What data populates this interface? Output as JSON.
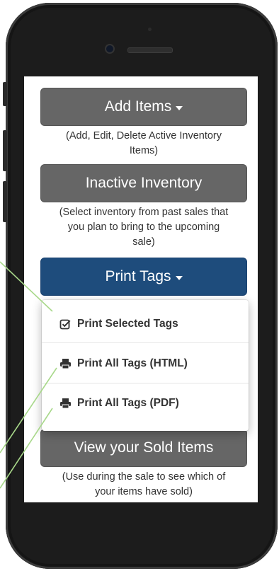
{
  "buttons": {
    "add_items": "Add Items",
    "inactive_inventory": "Inactive Inventory",
    "print_tags": "Print Tags",
    "view_sold": "View your Sold Items"
  },
  "descriptions": {
    "add_items_line1": "(Add, Edit, Delete Active Inventory",
    "add_items_line2": "Items)",
    "inactive_line1": "(Select inventory from past sales that",
    "inactive_line2": "you plan to bring to the upcoming",
    "inactive_line3": "sale)",
    "sold_line1": "(Use during the sale to see which of",
    "sold_line2": "your items have sold)"
  },
  "print_menu": {
    "items": [
      {
        "label": "Print Selected Tags",
        "icon": "check-square-icon"
      },
      {
        "label": "Print All Tags (HTML)",
        "icon": "print-icon"
      },
      {
        "label": "Print All Tags (PDF)",
        "icon": "print-icon"
      }
    ]
  },
  "colors": {
    "primary_button": "#1e4c7c",
    "secondary_button": "#666666",
    "callout_line": "#a8d88a"
  }
}
